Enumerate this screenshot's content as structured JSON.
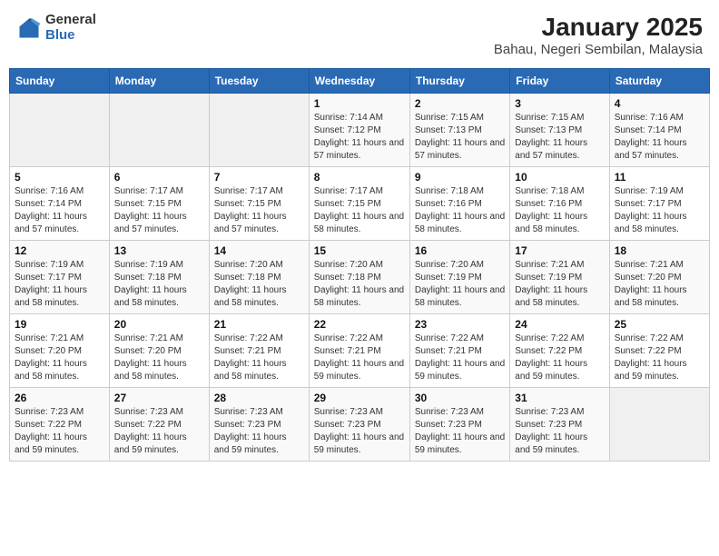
{
  "header": {
    "logo_general": "General",
    "logo_blue": "Blue",
    "title": "January 2025",
    "subtitle": "Bahau, Negeri Sembilan, Malaysia"
  },
  "calendar": {
    "days_of_week": [
      "Sunday",
      "Monday",
      "Tuesday",
      "Wednesday",
      "Thursday",
      "Friday",
      "Saturday"
    ],
    "weeks": [
      [
        {
          "day": "",
          "info": ""
        },
        {
          "day": "",
          "info": ""
        },
        {
          "day": "",
          "info": ""
        },
        {
          "day": "1",
          "info": "Sunrise: 7:14 AM\nSunset: 7:12 PM\nDaylight: 11 hours and 57 minutes."
        },
        {
          "day": "2",
          "info": "Sunrise: 7:15 AM\nSunset: 7:13 PM\nDaylight: 11 hours and 57 minutes."
        },
        {
          "day": "3",
          "info": "Sunrise: 7:15 AM\nSunset: 7:13 PM\nDaylight: 11 hours and 57 minutes."
        },
        {
          "day": "4",
          "info": "Sunrise: 7:16 AM\nSunset: 7:14 PM\nDaylight: 11 hours and 57 minutes."
        }
      ],
      [
        {
          "day": "5",
          "info": "Sunrise: 7:16 AM\nSunset: 7:14 PM\nDaylight: 11 hours and 57 minutes."
        },
        {
          "day": "6",
          "info": "Sunrise: 7:17 AM\nSunset: 7:15 PM\nDaylight: 11 hours and 57 minutes."
        },
        {
          "day": "7",
          "info": "Sunrise: 7:17 AM\nSunset: 7:15 PM\nDaylight: 11 hours and 57 minutes."
        },
        {
          "day": "8",
          "info": "Sunrise: 7:17 AM\nSunset: 7:15 PM\nDaylight: 11 hours and 58 minutes."
        },
        {
          "day": "9",
          "info": "Sunrise: 7:18 AM\nSunset: 7:16 PM\nDaylight: 11 hours and 58 minutes."
        },
        {
          "day": "10",
          "info": "Sunrise: 7:18 AM\nSunset: 7:16 PM\nDaylight: 11 hours and 58 minutes."
        },
        {
          "day": "11",
          "info": "Sunrise: 7:19 AM\nSunset: 7:17 PM\nDaylight: 11 hours and 58 minutes."
        }
      ],
      [
        {
          "day": "12",
          "info": "Sunrise: 7:19 AM\nSunset: 7:17 PM\nDaylight: 11 hours and 58 minutes."
        },
        {
          "day": "13",
          "info": "Sunrise: 7:19 AM\nSunset: 7:18 PM\nDaylight: 11 hours and 58 minutes."
        },
        {
          "day": "14",
          "info": "Sunrise: 7:20 AM\nSunset: 7:18 PM\nDaylight: 11 hours and 58 minutes."
        },
        {
          "day": "15",
          "info": "Sunrise: 7:20 AM\nSunset: 7:18 PM\nDaylight: 11 hours and 58 minutes."
        },
        {
          "day": "16",
          "info": "Sunrise: 7:20 AM\nSunset: 7:19 PM\nDaylight: 11 hours and 58 minutes."
        },
        {
          "day": "17",
          "info": "Sunrise: 7:21 AM\nSunset: 7:19 PM\nDaylight: 11 hours and 58 minutes."
        },
        {
          "day": "18",
          "info": "Sunrise: 7:21 AM\nSunset: 7:20 PM\nDaylight: 11 hours and 58 minutes."
        }
      ],
      [
        {
          "day": "19",
          "info": "Sunrise: 7:21 AM\nSunset: 7:20 PM\nDaylight: 11 hours and 58 minutes."
        },
        {
          "day": "20",
          "info": "Sunrise: 7:21 AM\nSunset: 7:20 PM\nDaylight: 11 hours and 58 minutes."
        },
        {
          "day": "21",
          "info": "Sunrise: 7:22 AM\nSunset: 7:21 PM\nDaylight: 11 hours and 58 minutes."
        },
        {
          "day": "22",
          "info": "Sunrise: 7:22 AM\nSunset: 7:21 PM\nDaylight: 11 hours and 59 minutes."
        },
        {
          "day": "23",
          "info": "Sunrise: 7:22 AM\nSunset: 7:21 PM\nDaylight: 11 hours and 59 minutes."
        },
        {
          "day": "24",
          "info": "Sunrise: 7:22 AM\nSunset: 7:22 PM\nDaylight: 11 hours and 59 minutes."
        },
        {
          "day": "25",
          "info": "Sunrise: 7:22 AM\nSunset: 7:22 PM\nDaylight: 11 hours and 59 minutes."
        }
      ],
      [
        {
          "day": "26",
          "info": "Sunrise: 7:23 AM\nSunset: 7:22 PM\nDaylight: 11 hours and 59 minutes."
        },
        {
          "day": "27",
          "info": "Sunrise: 7:23 AM\nSunset: 7:22 PM\nDaylight: 11 hours and 59 minutes."
        },
        {
          "day": "28",
          "info": "Sunrise: 7:23 AM\nSunset: 7:23 PM\nDaylight: 11 hours and 59 minutes."
        },
        {
          "day": "29",
          "info": "Sunrise: 7:23 AM\nSunset: 7:23 PM\nDaylight: 11 hours and 59 minutes."
        },
        {
          "day": "30",
          "info": "Sunrise: 7:23 AM\nSunset: 7:23 PM\nDaylight: 11 hours and 59 minutes."
        },
        {
          "day": "31",
          "info": "Sunrise: 7:23 AM\nSunset: 7:23 PM\nDaylight: 11 hours and 59 minutes."
        },
        {
          "day": "",
          "info": ""
        }
      ]
    ]
  }
}
